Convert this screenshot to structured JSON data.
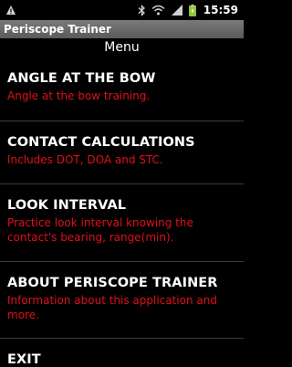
{
  "status_bar": {
    "time": "15:59",
    "icons": [
      "warning-icon",
      "bluetooth-icon",
      "wifi-icon",
      "signal-icon",
      "battery-icon"
    ]
  },
  "title_bar": {
    "title": "Periscope Trainer"
  },
  "menu": {
    "heading": "Menu",
    "items": [
      {
        "title": "ANGLE AT THE BOW",
        "description": "Angle at the bow training."
      },
      {
        "title": "CONTACT CALCULATIONS",
        "description": "Includes DOT, DOA and STC."
      },
      {
        "title": "LOOK INTERVAL",
        "description": "Practice look interval knowing the contact's bearing, range(min)."
      },
      {
        "title": "ABOUT PERISCOPE TRAINER",
        "description": "Information about this application and more."
      },
      {
        "title": "EXIT",
        "description": ""
      }
    ]
  },
  "colors": {
    "description_text": "#e0101a",
    "title_text": "#ffffff",
    "background": "#000000",
    "title_bar": "#6a6a6a"
  }
}
